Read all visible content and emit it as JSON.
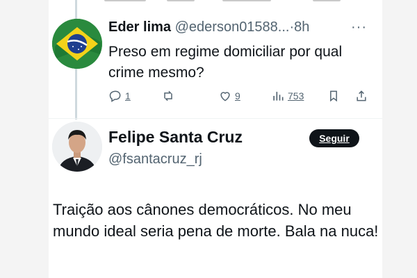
{
  "reply": {
    "author_name": "Eder lima",
    "handle": "@ederson01588...",
    "separator": "·",
    "time": "8h",
    "more": "···",
    "text": "Preso em regime domiciliar por qual crime mesmo?",
    "actions": {
      "reply_count": "1",
      "repost_count": "",
      "like_count": "9",
      "view_count": "753"
    },
    "avatar_icon": "brazil-flag-avatar"
  },
  "main_post": {
    "author_name": "Felipe Santa Cruz",
    "handle": "@fsantacruz_rj",
    "follow_label": "Seguir",
    "text": "Traição aos cânones democráticos. No meu mundo ideal seria pena de morte. Bala na nuca!",
    "avatar_icon": "profile-photo-avatar"
  },
  "colors": {
    "text": "#0f1419",
    "muted": "#536471",
    "button_bg": "#0f1419",
    "thread_line": "#cfd9de"
  }
}
